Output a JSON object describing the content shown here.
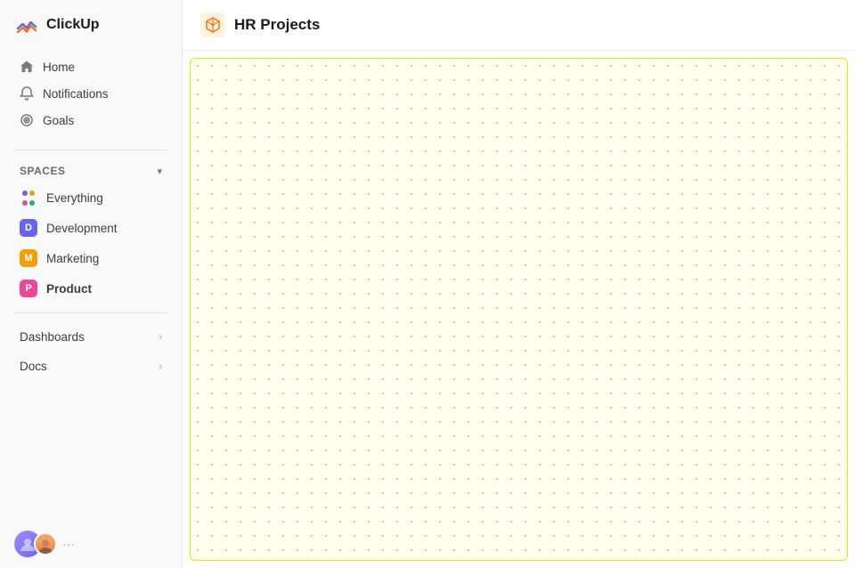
{
  "app": {
    "name": "ClickUp"
  },
  "sidebar": {
    "nav": [
      {
        "id": "home",
        "label": "Home",
        "icon": "home"
      },
      {
        "id": "notifications",
        "label": "Notifications",
        "icon": "bell"
      },
      {
        "id": "goals",
        "label": "Goals",
        "icon": "target"
      }
    ],
    "spaces_label": "Spaces",
    "spaces": [
      {
        "id": "everything",
        "label": "Everything",
        "type": "dots"
      },
      {
        "id": "development",
        "label": "Development",
        "type": "badge",
        "color": "#6366f1",
        "letter": "D"
      },
      {
        "id": "marketing",
        "label": "Marketing",
        "type": "badge",
        "color": "#f59e0b",
        "letter": "M"
      },
      {
        "id": "product",
        "label": "Product",
        "type": "badge",
        "color": "#ec4899",
        "letter": "P",
        "active": true
      }
    ],
    "collapsibles": [
      {
        "id": "dashboards",
        "label": "Dashboards"
      },
      {
        "id": "docs",
        "label": "Docs"
      }
    ]
  },
  "main": {
    "page_title": "HR Projects"
  }
}
